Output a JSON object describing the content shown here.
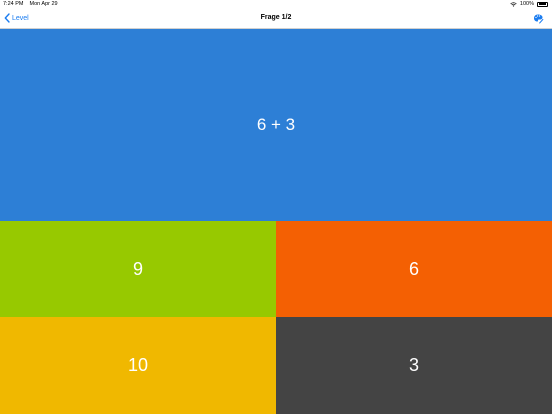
{
  "status_bar": {
    "time": "7:24 PM",
    "date": "Mon Apr 29",
    "battery": "100%",
    "icons": [
      "wifi-icon",
      "battery-icon"
    ]
  },
  "nav": {
    "back_label": "Level",
    "back_icon": "chevron-left-icon",
    "title": "Frage 1/2",
    "palette_icon": "palette-icon",
    "accent_color": "#1a7cf0"
  },
  "question": {
    "text": "6 + 3",
    "color": "#2d7fd6"
  },
  "answers": [
    {
      "label": "9",
      "color": "#97c900"
    },
    {
      "label": "6",
      "color": "#f46003"
    },
    {
      "label": "10",
      "color": "#f0b800"
    },
    {
      "label": "3",
      "color": "#444444"
    }
  ]
}
